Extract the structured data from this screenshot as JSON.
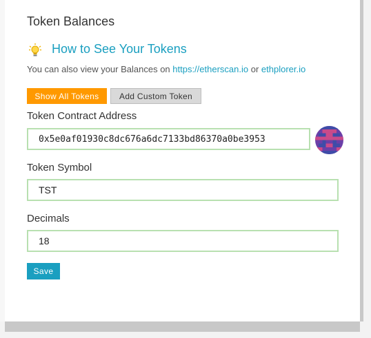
{
  "panel": {
    "title": "Token Balances",
    "howto_link": "How to See Your Tokens",
    "info_prefix": "You can also view your Balances on ",
    "info_link_1": "https://etherscan.io",
    "info_middle": " or ",
    "info_link_2": "ethplorer.io"
  },
  "buttons": {
    "show_all": "Show All Tokens",
    "add_custom": "Add Custom Token",
    "save": "Save"
  },
  "form": {
    "contract_label": "Token Contract Address",
    "contract_value": "0x5e0af01930c8dc676a6dc7133bd86370a0be3953",
    "symbol_label": "Token Symbol",
    "symbol_value": "TST",
    "decimals_label": "Decimals",
    "decimals_value": "18"
  },
  "colors": {
    "accent_orange": "#ff9900",
    "link_blue": "#1a9fc0",
    "field_border": "#b8e0b0"
  },
  "icons": {
    "lightbulb": "lightbulb-icon",
    "identicon": "address-identicon"
  }
}
